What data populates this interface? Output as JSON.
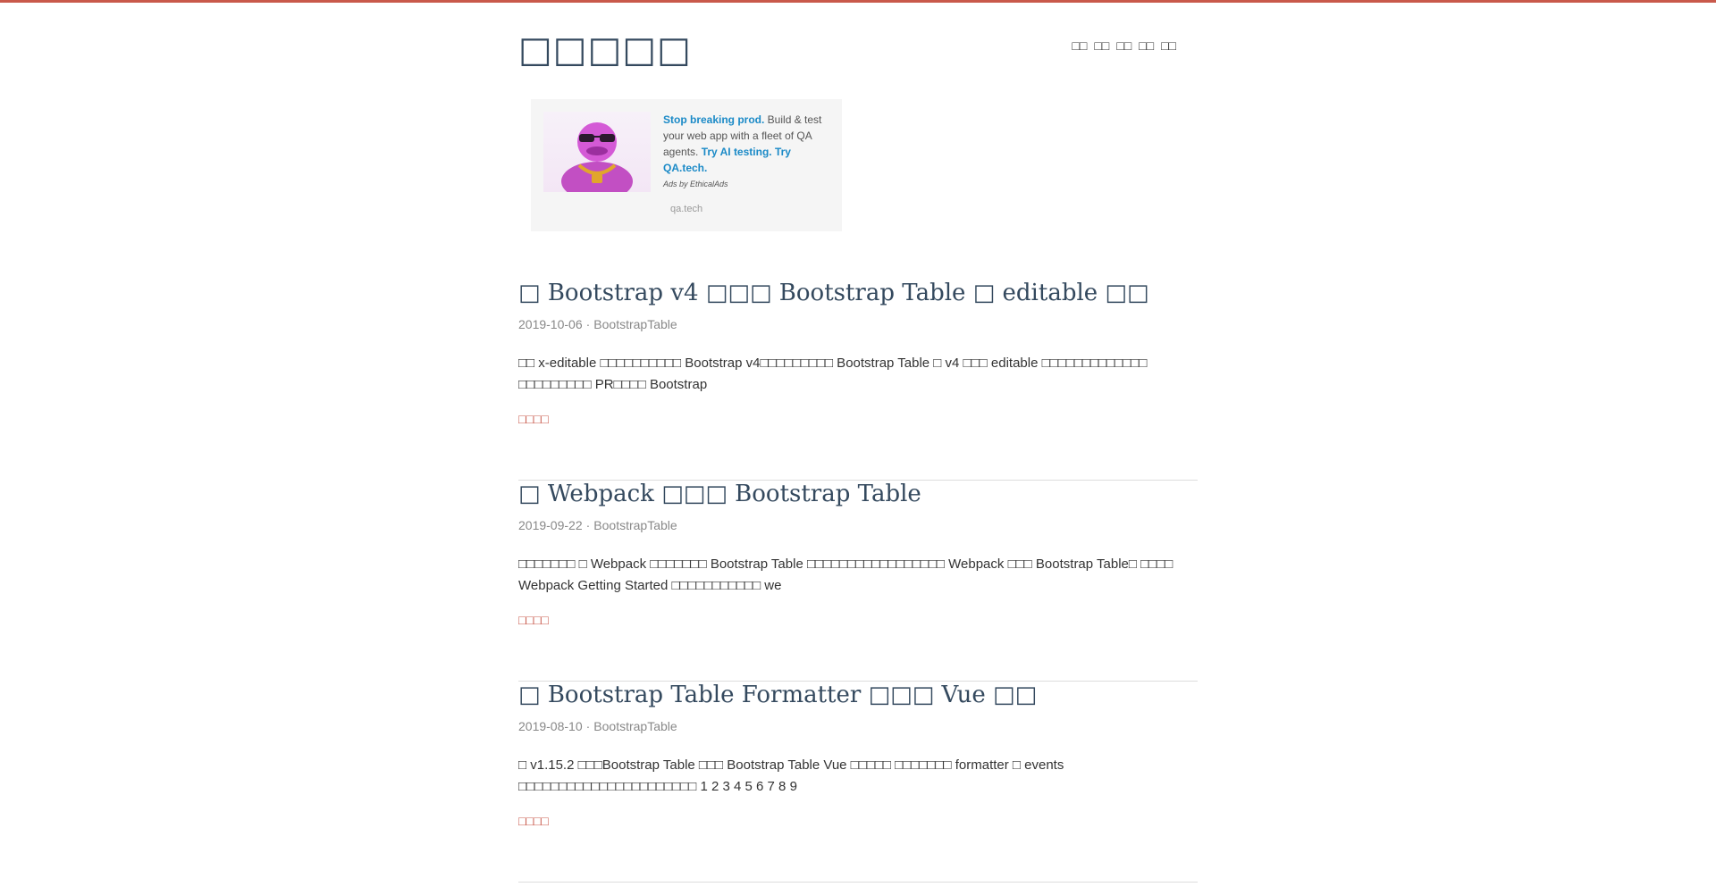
{
  "site": {
    "title": "□□□□□"
  },
  "nav": {
    "items": [
      "□□",
      "□□",
      "□□",
      "□□",
      "□□"
    ]
  },
  "ad": {
    "text_1": "Stop breaking prod.",
    "text_2": " Build & test your web app with a fleet of QA agents. ",
    "text_3": "Try AI testing. Try QA.tech.",
    "by": "Ads by EthicalAds",
    "domain": "qa.tech"
  },
  "posts": [
    {
      "title": "□ Bootstrap v4 □□□ Bootstrap Table □ editable □□",
      "date": "2019-10-06",
      "category": "BootstrapTable",
      "excerpt": "□□ x-editable □□□□□□□□□□ Bootstrap v4□□□□□□□□□ Bootstrap Table □ v4 □□□ editable □□□□□□□□□□□□□ □□□□□□□□□ PR□□□□ Bootstrap",
      "read_more": "□□□□"
    },
    {
      "title": "□ Webpack □□□ Bootstrap Table",
      "date": "2019-09-22",
      "category": "BootstrapTable",
      "excerpt": "□□□□□□□ □ Webpack □□□□□□□ Bootstrap Table □□□□□□□□□□□□□□□□□ Webpack □□□ Bootstrap Table□ □□□□ Webpack Getting Started □□□□□□□□□□□ we",
      "read_more": "□□□□"
    },
    {
      "title": "□ Bootstrap Table Formatter □□□ Vue □□",
      "date": "2019-08-10",
      "category": "BootstrapTable",
      "excerpt": "□ v1.15.2 □□□Bootstrap Table □□□ Bootstrap Table Vue □□□□□ □□□□□□□ formatter □ events □□□□□□□□□□□□□□□□□□□□□□ 1 2 3 4 5 6 7 8 9",
      "read_more": "□□□□"
    }
  ]
}
